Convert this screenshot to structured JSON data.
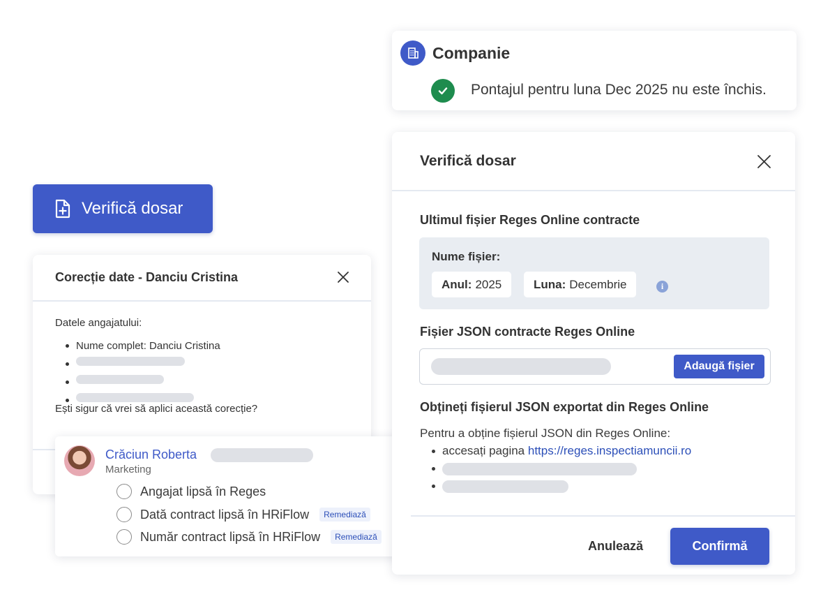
{
  "company": {
    "title": "Companie",
    "status_message": "Pontajul pentru luna Dec 2025 nu este închis.",
    "icon": "building-icon",
    "status_icon": "check-circle-icon"
  },
  "primary_button": {
    "label": "Verifică dosar",
    "icon": "file-plus-icon"
  },
  "corectie_modal": {
    "title": "Corecție date - Danciu Cristina",
    "lead": "Datele angajatului:",
    "items": [
      "Nume complet: Danciu Cristina"
    ],
    "question": "Ești sigur că vrei să aplici această corecție?"
  },
  "employee_card": {
    "name": "Crăciun Roberta",
    "department": "Marketing",
    "issues": [
      {
        "label": "Angajat lipsă în Reges",
        "action": ""
      },
      {
        "label": "Dată contract lipsă în HRiFlow",
        "action": "Remediază"
      },
      {
        "label": "Număr contract lipsă în HRiFlow",
        "action": "Remediază"
      }
    ]
  },
  "dosar_modal": {
    "title": "Verifică dosar",
    "last_file_heading": "Ultimul fișier Reges Online contracte",
    "file_name_label": "Nume fișier:",
    "year_label": "Anul:",
    "year_value": "2025",
    "month_label": "Luna:",
    "month_value": "Decembrie",
    "json_heading": "Fișier JSON contracte Reges Online",
    "add_file_button": "Adaugă fișier",
    "obtain_heading": "Obțineți fișierul JSON exportat din Reges Online",
    "obtain_intro": "Pentru a obține fișierul JSON din Reges Online:",
    "step1_text": "accesați pagina",
    "step1_link": "https://reges.inspectiamuncii.ro",
    "cancel_label": "Anulează",
    "confirm_label": "Confirmă"
  },
  "colors": {
    "primary": "#3f5ac8",
    "success": "#1e8c4e",
    "placeholder": "#dfe1e6"
  }
}
